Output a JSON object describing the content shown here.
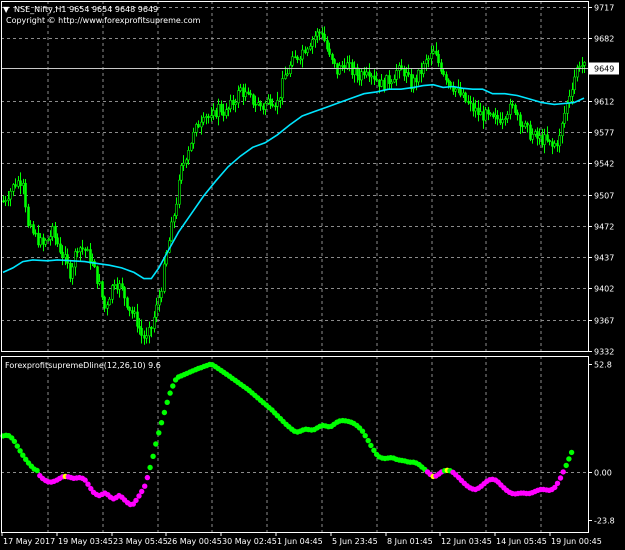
{
  "window": {
    "symbol_header": "NSE_Nifty,H1  9654 9654 9648 9649",
    "copyright": "Copyright © http://www.forexprofitsupreme.com",
    "dropdown_glyph": "▼"
  },
  "colors": {
    "background": "#000000",
    "grid": "#8c8c8c",
    "candle": "#00ff00",
    "moving_average": "#00e5ff",
    "dot_up": "#00ff00",
    "dot_down": "#ff00ff",
    "dot_neutral": "#ffff00",
    "price_marker_bg": "#ffffff",
    "price_marker_text": "#000000",
    "text": "#ffffff"
  },
  "chart_data": [
    {
      "type": "candlestick",
      "title": "NSE_Nifty,H1",
      "ylim": [
        9332,
        9717
      ],
      "y_ticks": [
        "9717",
        "9682",
        "9649",
        "9612",
        "9577",
        "9542",
        "9507",
        "9472",
        "9437",
        "9402",
        "9367",
        "9332"
      ],
      "current_price": "9649",
      "x_tick_labels": [
        "17 May 2017",
        "19 May 03:45",
        "23 May 05:45",
        "26 May 00:45",
        "30 May 02:45",
        "1 Jun 04:45",
        "5 Jun 23:45",
        "8 Jun 01:45",
        "12 Jun 03:45",
        "14 Jun 05:45",
        "19 Jun 00:45"
      ],
      "close_path": [
        [
          0,
          9500
        ],
        [
          2,
          9508
        ],
        [
          5,
          9520
        ],
        [
          8,
          9525
        ],
        [
          10,
          9470
        ],
        [
          13,
          9460
        ],
        [
          16,
          9450
        ],
        [
          20,
          9465
        ],
        [
          24,
          9440
        ],
        [
          27,
          9420
        ],
        [
          30,
          9450
        ],
        [
          33,
          9445
        ],
        [
          36,
          9430
        ],
        [
          39,
          9405
        ],
        [
          41,
          9380
        ],
        [
          43,
          9395
        ],
        [
          45,
          9412
        ],
        [
          48,
          9400
        ],
        [
          51,
          9380
        ],
        [
          54,
          9365
        ],
        [
          56,
          9350
        ],
        [
          58,
          9345
        ],
        [
          60,
          9358
        ],
        [
          62,
          9380
        ],
        [
          64,
          9405
        ],
        [
          66,
          9440
        ],
        [
          68,
          9470
        ],
        [
          70,
          9500
        ],
        [
          72,
          9535
        ],
        [
          75,
          9560
        ],
        [
          78,
          9580
        ],
        [
          81,
          9600
        ],
        [
          84,
          9590
        ],
        [
          87,
          9605
        ],
        [
          90,
          9598
        ],
        [
          93,
          9610
        ],
        [
          96,
          9625
        ],
        [
          99,
          9615
        ],
        [
          102,
          9610
        ],
        [
          105,
          9605
        ],
        [
          108,
          9615
        ],
        [
          111,
          9610
        ],
        [
          114,
          9640
        ],
        [
          117,
          9655
        ],
        [
          120,
          9665
        ],
        [
          123,
          9675
        ],
        [
          126,
          9685
        ],
        [
          129,
          9690
        ],
        [
          132,
          9660
        ],
        [
          135,
          9645
        ],
        [
          138,
          9655
        ],
        [
          141,
          9645
        ],
        [
          144,
          9640
        ],
        [
          147,
          9650
        ],
        [
          150,
          9640
        ],
        [
          153,
          9630
        ],
        [
          156,
          9635
        ],
        [
          159,
          9645
        ],
        [
          162,
          9645
        ],
        [
          165,
          9630
        ],
        [
          168,
          9640
        ],
        [
          171,
          9655
        ],
        [
          174,
          9665
        ],
        [
          177,
          9650
        ],
        [
          180,
          9635
        ],
        [
          183,
          9625
        ],
        [
          186,
          9615
        ],
        [
          189,
          9605
        ],
        [
          192,
          9598
        ],
        [
          195,
          9595
        ],
        [
          198,
          9590
        ],
        [
          201,
          9593
        ],
        [
          204,
          9602
        ],
        [
          207,
          9604
        ],
        [
          210,
          9585
        ],
        [
          213,
          9575
        ],
        [
          216,
          9570
        ],
        [
          219,
          9568
        ],
        [
          222,
          9560
        ],
        [
          225,
          9570
        ],
        [
          227,
          9598
        ],
        [
          229,
          9620
        ],
        [
          231,
          9640
        ],
        [
          233,
          9655
        ],
        [
          235,
          9649
        ]
      ],
      "moving_average": [
        [
          0,
          9420
        ],
        [
          4,
          9425
        ],
        [
          8,
          9432
        ],
        [
          12,
          9434
        ],
        [
          18,
          9433
        ],
        [
          22,
          9434
        ],
        [
          28,
          9433
        ],
        [
          33,
          9432
        ],
        [
          38,
          9430
        ],
        [
          43,
          9428
        ],
        [
          48,
          9425
        ],
        [
          53,
          9420
        ],
        [
          57,
          9413
        ],
        [
          60,
          9413
        ],
        [
          63,
          9425
        ],
        [
          67,
          9445
        ],
        [
          71,
          9465
        ],
        [
          76,
          9485
        ],
        [
          81,
          9505
        ],
        [
          86,
          9522
        ],
        [
          91,
          9538
        ],
        [
          96,
          9550
        ],
        [
          101,
          9560
        ],
        [
          106,
          9565
        ],
        [
          111,
          9574
        ],
        [
          116,
          9585
        ],
        [
          121,
          9595
        ],
        [
          126,
          9600
        ],
        [
          131,
          9605
        ],
        [
          136,
          9610
        ],
        [
          141,
          9615
        ],
        [
          146,
          9620
        ],
        [
          151,
          9622
        ],
        [
          156,
          9625
        ],
        [
          161,
          9625
        ],
        [
          166,
          9627
        ],
        [
          170,
          9629
        ],
        [
          174,
          9630
        ],
        [
          178,
          9627
        ],
        [
          182,
          9628
        ],
        [
          186,
          9626
        ],
        [
          190,
          9625
        ],
        [
          194,
          9625
        ],
        [
          198,
          9620
        ],
        [
          203,
          9620
        ],
        [
          208,
          9618
        ],
        [
          213,
          9614
        ],
        [
          218,
          9610
        ],
        [
          223,
          9608
        ],
        [
          227,
          9609
        ],
        [
          231,
          9610
        ],
        [
          235,
          9615
        ]
      ]
    },
    {
      "type": "scatter",
      "title": "ForexprofitsupremeDline(12,26,10) 9.6",
      "ylim": [
        -23.8,
        52.8
      ],
      "y_ticks": [
        "52.8",
        "0.00",
        "-23.8"
      ],
      "dots_up_color_on": "rising",
      "values": [
        [
          0,
          17.5
        ],
        [
          1.2,
          17.8
        ],
        [
          2.3,
          17.6
        ],
        [
          3.5,
          16.5
        ],
        [
          4.6,
          14.8
        ],
        [
          5.8,
          12.5
        ],
        [
          6.9,
          10.2
        ],
        [
          8,
          8
        ],
        [
          9.2,
          6
        ],
        [
          10.3,
          4.2
        ],
        [
          11.5,
          2.6
        ],
        [
          12.6,
          1.2
        ],
        [
          13.8,
          0.5
        ],
        [
          14.9,
          -2
        ],
        [
          16,
          -3.4
        ],
        [
          17.2,
          -4.4
        ],
        [
          18.3,
          -5
        ],
        [
          19.5,
          -5.2
        ],
        [
          20.6,
          -4.8
        ],
        [
          21.8,
          -4.2
        ],
        [
          22.9,
          -3.4
        ],
        [
          24.1,
          -2.6
        ],
        [
          25.2,
          -2.4
        ],
        [
          26.4,
          -2.6
        ],
        [
          27.5,
          -3
        ],
        [
          28.6,
          -3.3
        ],
        [
          29.8,
          -3.2
        ],
        [
          30.9,
          -3
        ],
        [
          32.1,
          -3.3
        ],
        [
          33.2,
          -4.2
        ],
        [
          34.4,
          -6.2
        ],
        [
          35.5,
          -8.4
        ],
        [
          36.6,
          -10.2
        ],
        [
          37.8,
          -11.3
        ],
        [
          38.9,
          -11.8
        ],
        [
          40.1,
          -11.2
        ],
        [
          41.2,
          -10.6
        ],
        [
          42.4,
          -11.4
        ],
        [
          43.5,
          -12.6
        ],
        [
          44.7,
          -13.4
        ],
        [
          45.8,
          -12.8
        ],
        [
          46.9,
          -11.8
        ],
        [
          48.1,
          -12.6
        ],
        [
          49.2,
          -14
        ],
        [
          50.4,
          -15.3
        ],
        [
          51.5,
          -16.2
        ],
        [
          52.7,
          -16
        ],
        [
          53.8,
          -14.2
        ],
        [
          55,
          -12
        ],
        [
          56.1,
          -9.8
        ],
        [
          57.3,
          -7.2
        ],
        [
          58.4,
          -3
        ],
        [
          59.5,
          2
        ],
        [
          60.7,
          7.5
        ],
        [
          61.8,
          13.5
        ],
        [
          63,
          19
        ],
        [
          64.1,
          24
        ],
        [
          65.3,
          29
        ],
        [
          66.4,
          34
        ],
        [
          67.6,
          38.5
        ],
        [
          68.7,
          42
        ],
        [
          69.8,
          45
        ],
        [
          71,
          46.4
        ],
        [
          72.1,
          47
        ],
        [
          73.3,
          47.6
        ],
        [
          74.4,
          48.2
        ],
        [
          75.6,
          48.8
        ],
        [
          76.7,
          49.4
        ],
        [
          77.9,
          50
        ],
        [
          79,
          50.6
        ],
        [
          80.1,
          51
        ],
        [
          81.3,
          51.6
        ],
        [
          82.4,
          52
        ],
        [
          83.6,
          52.6
        ],
        [
          84.7,
          52.4
        ],
        [
          85.9,
          51.5
        ],
        [
          87,
          50.6
        ],
        [
          88.2,
          49.6
        ],
        [
          89.3,
          48.7
        ],
        [
          90.4,
          47.8
        ],
        [
          91.6,
          46.8
        ],
        [
          92.7,
          45.8
        ],
        [
          93.9,
          44.8
        ],
        [
          95,
          43.8
        ],
        [
          96.2,
          42.8
        ],
        [
          97.3,
          41.8
        ],
        [
          98.5,
          40.8
        ],
        [
          99.6,
          39.8
        ],
        [
          100.7,
          38.6
        ],
        [
          101.9,
          37.4
        ],
        [
          103,
          36.2
        ],
        [
          104.2,
          35
        ],
        [
          105.3,
          33.8
        ],
        [
          106.5,
          32.6
        ],
        [
          107.6,
          31.4
        ],
        [
          108.8,
          30.2
        ],
        [
          109.9,
          28.8
        ],
        [
          111,
          27.4
        ],
        [
          112.2,
          26
        ],
        [
          113.3,
          24.6
        ],
        [
          114.5,
          23.2
        ],
        [
          115.6,
          22
        ],
        [
          116.8,
          20.8
        ],
        [
          117.9,
          19.8
        ],
        [
          119.1,
          19.4
        ],
        [
          120.2,
          19.8
        ],
        [
          121.3,
          20.4
        ],
        [
          122.5,
          20.8
        ],
        [
          123.6,
          20.6
        ],
        [
          124.8,
          20.4
        ],
        [
          125.9,
          20.6
        ],
        [
          127.1,
          21.4
        ],
        [
          128.2,
          22.2
        ],
        [
          129.4,
          22.6
        ],
        [
          130.5,
          22.4
        ],
        [
          131.6,
          22
        ],
        [
          132.8,
          22.2
        ],
        [
          133.9,
          23.2
        ],
        [
          135.1,
          24.2
        ],
        [
          136.2,
          24.8
        ],
        [
          137.4,
          25
        ],
        [
          138.5,
          24.9
        ],
        [
          139.7,
          24.6
        ],
        [
          140.8,
          24.2
        ],
        [
          141.9,
          23.6
        ],
        [
          143.1,
          22.6
        ],
        [
          144.2,
          21.4
        ],
        [
          145.4,
          19.8
        ],
        [
          146.5,
          17.6
        ],
        [
          147.7,
          15.2
        ],
        [
          148.8,
          12.8
        ],
        [
          150,
          10.4
        ],
        [
          151.1,
          8.4
        ],
        [
          152.2,
          7.2
        ],
        [
          153.4,
          6.6
        ],
        [
          154.5,
          6.4
        ],
        [
          155.7,
          6.6
        ],
        [
          156.8,
          6.8
        ],
        [
          158,
          6.6
        ],
        [
          159.1,
          6
        ],
        [
          160.3,
          5.6
        ],
        [
          161.4,
          5.4
        ],
        [
          162.5,
          5.2
        ],
        [
          163.7,
          4.8
        ],
        [
          164.8,
          4.6
        ],
        [
          166,
          4.6
        ],
        [
          167.1,
          4.2
        ],
        [
          168.3,
          3.4
        ],
        [
          169.4,
          2.2
        ],
        [
          170.6,
          1
        ],
        [
          171.7,
          -0.2
        ],
        [
          172.8,
          -1.4
        ],
        [
          174,
          -2.4
        ],
        [
          175.1,
          -2.2
        ],
        [
          176.3,
          -1.2
        ],
        [
          177.4,
          -0.2
        ],
        [
          178.6,
          0.4
        ],
        [
          179.7,
          0.6
        ],
        [
          180.8,
          0.4
        ],
        [
          182,
          -0.4
        ],
        [
          183.1,
          -1.6
        ],
        [
          184.3,
          -3
        ],
        [
          185.4,
          -4.4
        ],
        [
          186.6,
          -5.8
        ],
        [
          187.7,
          -7
        ],
        [
          188.9,
          -8
        ],
        [
          190,
          -8.6
        ],
        [
          191.1,
          -8.8
        ],
        [
          192.3,
          -8.2
        ],
        [
          193.4,
          -7.2
        ],
        [
          194.6,
          -6
        ],
        [
          195.7,
          -4.8
        ],
        [
          196.9,
          -4
        ],
        [
          198,
          -3.8
        ],
        [
          199.2,
          -4.2
        ],
        [
          200.3,
          -5.2
        ],
        [
          201.4,
          -6.6
        ],
        [
          202.6,
          -8
        ],
        [
          203.7,
          -9.2
        ],
        [
          204.9,
          -10.2
        ],
        [
          206,
          -10.8
        ],
        [
          207.2,
          -11
        ],
        [
          208.3,
          -10.8
        ],
        [
          209.5,
          -10.6
        ],
        [
          210.6,
          -10.6
        ],
        [
          211.7,
          -10.8
        ],
        [
          212.9,
          -10.8
        ],
        [
          214,
          -10.4
        ],
        [
          215.2,
          -9.8
        ],
        [
          216.3,
          -9.2
        ],
        [
          217.5,
          -8.8
        ],
        [
          218.6,
          -8.8
        ],
        [
          219.8,
          -9
        ],
        [
          220.9,
          -9.2
        ],
        [
          222,
          -8.8
        ],
        [
          223.2,
          -7.8
        ],
        [
          224.3,
          -5.8
        ],
        [
          225.5,
          -3.2
        ],
        [
          226.6,
          -0.2
        ],
        [
          227.8,
          3
        ],
        [
          228.9,
          6.2
        ],
        [
          230,
          9.4
        ]
      ]
    }
  ]
}
